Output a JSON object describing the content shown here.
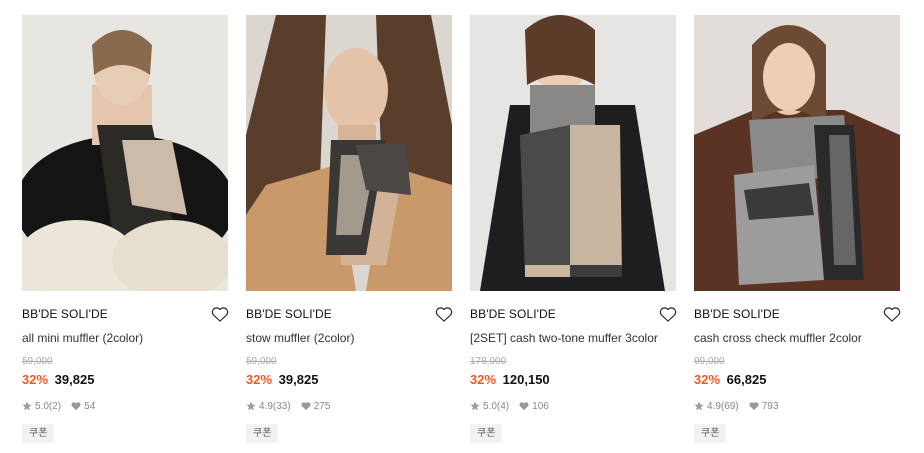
{
  "products": [
    {
      "brand": "BB'DE SOLI'DE",
      "name": "all mini muffler (2color)",
      "original_price": "59,000",
      "discount": "32%",
      "price": "39,825",
      "rating": "5.0",
      "review_count": "(2)",
      "likes": "54",
      "coupon": "쿠폰"
    },
    {
      "brand": "BB'DE SOLI'DE",
      "name": "stow muffler (2color)",
      "original_price": "59,000",
      "discount": "32%",
      "price": "39,825",
      "rating": "4.9",
      "review_count": "(33)",
      "likes": "275",
      "coupon": "쿠폰"
    },
    {
      "brand": "BB'DE SOLI'DE",
      "name": "[2SET] cash two-tone muffer 3color",
      "original_price": "178,000",
      "discount": "32%",
      "price": "120,150",
      "rating": "5.0",
      "review_count": "(4)",
      "likes": "106",
      "coupon": "쿠폰"
    },
    {
      "brand": "BB'DE SOLI'DE",
      "name": "cash cross check muffler 2color",
      "original_price": "99,000",
      "discount": "32%",
      "price": "66,825",
      "rating": "4.9",
      "review_count": "(69)",
      "likes": "793",
      "coupon": "쿠폰"
    }
  ],
  "colors": {
    "discount": "#f15a24",
    "strike_price": "#aaaaaa",
    "meta": "#888888",
    "coupon_bg": "#f2f2f2"
  },
  "icons": {
    "like": "heart-outline-icon",
    "rating": "star-icon",
    "likes_count": "heart-filled-icon"
  }
}
